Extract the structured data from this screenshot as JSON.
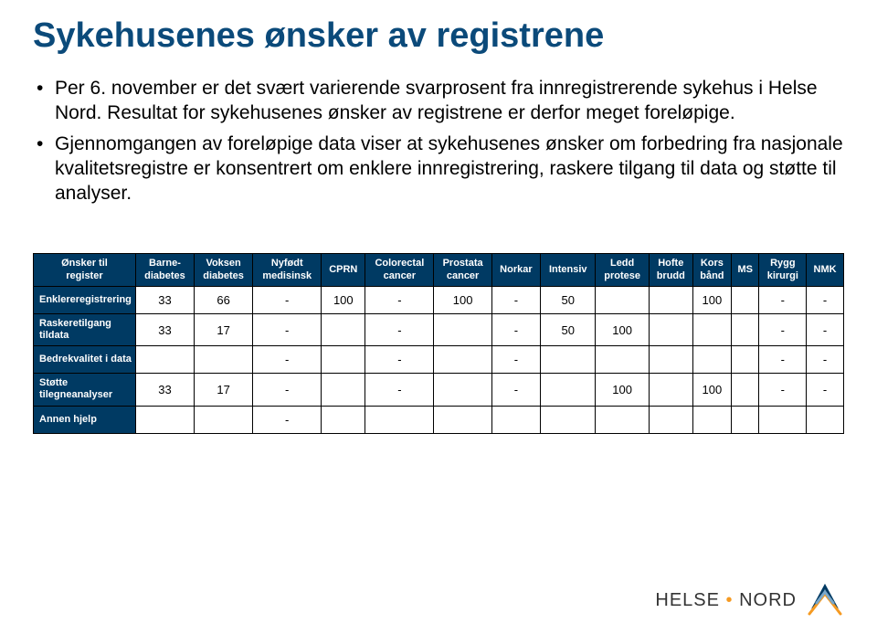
{
  "title": "Sykehusenes ønsker av registrene",
  "bullet1": "Per 6. november er det svært varierende svarprosent fra innregistrerende sykehus i Helse Nord. Resultat for sykehusenes ønsker av registrene er derfor meget foreløpige.",
  "bullet2": "Gjennomgangen av foreløpige data viser at sykehusenes ønsker om forbedring fra nasjonale kvalitetsregistre er konsentrert om enklere innregistrering, raskere tilgang til data og støtte til analyser.",
  "table": {
    "h0a": "Ønsker til",
    "h0b": "register",
    "h1a": "Barne-",
    "h1b": "diabetes",
    "h2a": "Voksen",
    "h2b": "diabetes",
    "h3a": "Nyfødt",
    "h3b": "medisinsk",
    "h4a": "CPRN",
    "h4b": "",
    "h5a": "Colorectal",
    "h5b": "cancer",
    "h6a": "Prostata",
    "h6b": "cancer",
    "h7a": "Norkar",
    "h7b": "",
    "h8a": "Intensiv",
    "h8b": "",
    "h9a": "Ledd",
    "h9b": "protese",
    "h10a": "Hofte",
    "h10b": "brudd",
    "h11a": "Kors",
    "h11b": "bånd",
    "h12a": "MS",
    "h12b": "",
    "h13a": "Rygg",
    "h13b": "kirurgi",
    "h14a": "NMK",
    "h14b": "",
    "r1": {
      "label1": "Enklere",
      "label2": "registrering",
      "c1": "33",
      "c2": "66",
      "c3": "-",
      "c4": "100",
      "c5": "-",
      "c6": "100",
      "c7": "-",
      "c8": "50",
      "c9": "",
      "c10": "",
      "c11": "100",
      "c12": "",
      "c13": "-",
      "c14": "-"
    },
    "r2": {
      "label1": "Raskere",
      "label2": "tilgang til",
      "label3": "data",
      "c1": "33",
      "c2": "17",
      "c3": "-",
      "c4": "",
      "c5": "-",
      "c6": "",
      "c7": "-",
      "c8": "50",
      "c9": "100",
      "c10": "",
      "c11": "",
      "c12": "",
      "c13": "-",
      "c14": "-"
    },
    "r3": {
      "label1": "Bedre",
      "label2": "kvalitet i data",
      "c1": "",
      "c2": "",
      "c3": "-",
      "c4": "",
      "c5": "-",
      "c6": "",
      "c7": "-",
      "c8": "",
      "c9": "",
      "c10": "",
      "c11": "",
      "c12": "",
      "c13": "-",
      "c14": "-"
    },
    "r4": {
      "label1": "Støtte til",
      "label2": "egne",
      "label3": "analyser",
      "c1": "33",
      "c2": "17",
      "c3": "-",
      "c4": "",
      "c5": "-",
      "c6": "",
      "c7": "-",
      "c8": "",
      "c9": "100",
      "c10": "",
      "c11": "100",
      "c12": "",
      "c13": "-",
      "c14": "-"
    },
    "r5": {
      "label1": "Annen hjelp",
      "c1": "",
      "c2": "",
      "c3": "-",
      "c4": "",
      "c5": "",
      "c6": "",
      "c7": "",
      "c8": "",
      "c9": "",
      "c10": "",
      "c11": "",
      "c12": "",
      "c13": "",
      "c14": ""
    }
  },
  "logo": {
    "word1": "HELSE",
    "word2": "NORD"
  }
}
